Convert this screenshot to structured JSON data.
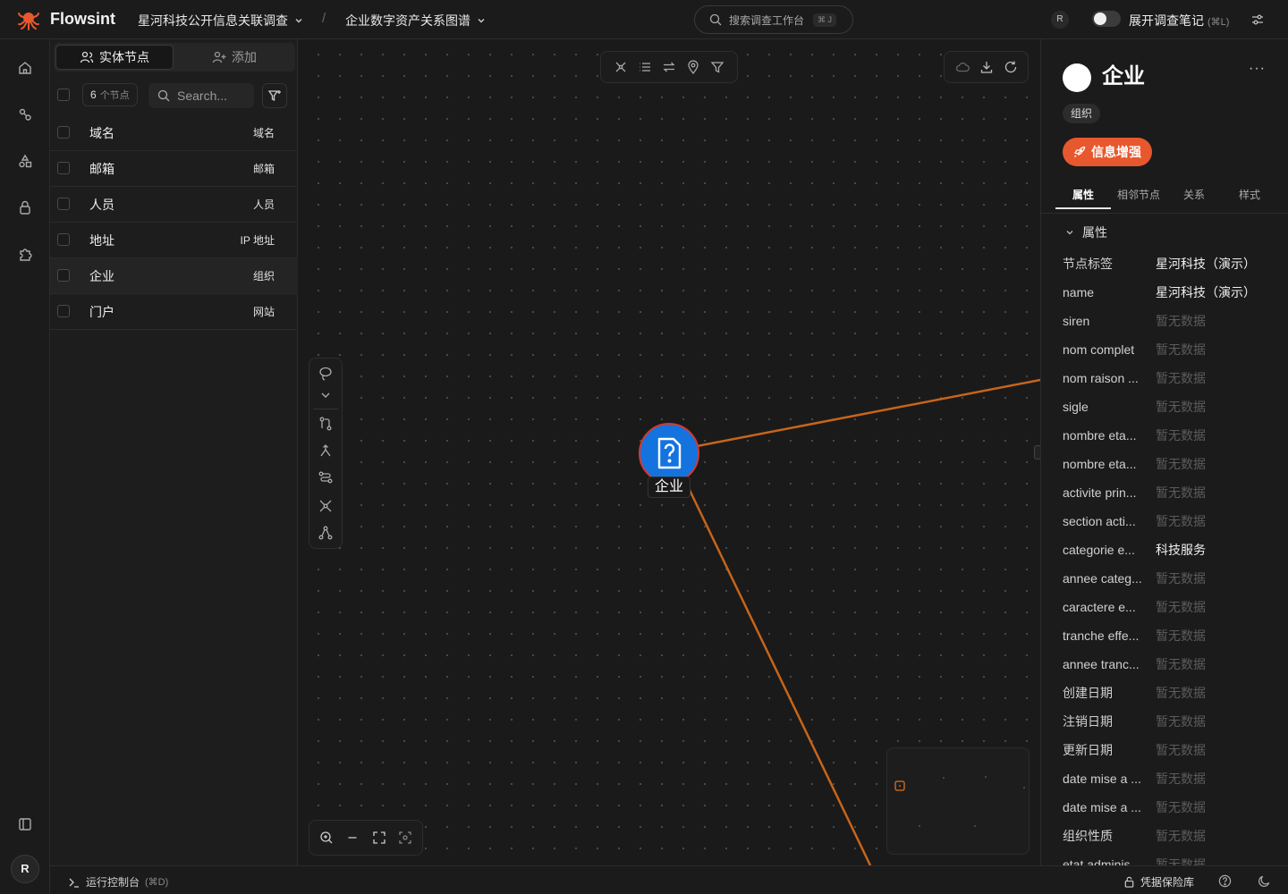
{
  "app": {
    "name": "Flowsint",
    "brand_color": "#e8582e"
  },
  "breadcrumb": {
    "investigation": "星河科技公开信息关联调查",
    "separator": "/",
    "sketch": "企业数字资产关系图谱"
  },
  "search": {
    "placeholder": "搜索调查工作台",
    "shortcut": "⌘ J"
  },
  "header": {
    "avatar": "R",
    "notes_label": "展开调查笔记",
    "notes_shortcut": "(⌘L)"
  },
  "sidebar_nav": {
    "icons": [
      "home-icon",
      "graph-icon",
      "shapes-icon",
      "lock-icon",
      "puzzle-icon"
    ],
    "bottom_icon": "panel-icon",
    "avatar": "R"
  },
  "entity_panel": {
    "tabs": [
      {
        "label": "实体节点",
        "active": true
      },
      {
        "label": "添加",
        "active": false
      }
    ],
    "count": "6",
    "count_unit": "个节点",
    "search_placeholder": "Search...",
    "rows": [
      {
        "name": "域名",
        "type": "域名",
        "selected": false
      },
      {
        "name": "邮箱",
        "type": "邮箱",
        "selected": false
      },
      {
        "name": "人员",
        "type": "人员",
        "selected": false
      },
      {
        "name": "地址",
        "type": "IP 地址",
        "selected": false
      },
      {
        "name": "企业",
        "type": "组织",
        "selected": true
      },
      {
        "name": "门户",
        "type": "网站",
        "selected": false
      }
    ]
  },
  "canvas": {
    "node": {
      "label": "企业",
      "icon": "question-document-icon",
      "fill": "#1573e0",
      "ring": "#d33a2f"
    },
    "edge_color": "#c7651a",
    "top_tools": [
      "layout-icon",
      "list-icon",
      "swap-icon",
      "map-pin-icon",
      "filter-icon"
    ],
    "right_tools": [
      "cloud-icon",
      "download-icon",
      "refresh-icon"
    ],
    "side_tools": [
      "lasso-icon",
      "chevron-down-icon",
      "git-compare-icon",
      "merge-icon",
      "route-icon",
      "network-icon",
      "hierarchy-icon"
    ],
    "zoom_tools": [
      "zoom-in-icon",
      "zoom-out-icon",
      "fit-view-icon",
      "focus-icon"
    ]
  },
  "detail": {
    "title": "企业",
    "badge": "组织",
    "more": "···",
    "enrich_label": "信息增强",
    "tabs": [
      {
        "label": "属性",
        "active": true
      },
      {
        "label": "相邻节点",
        "active": false
      },
      {
        "label": "关系",
        "active": false
      },
      {
        "label": "样式",
        "active": false
      }
    ],
    "section_title": "属性",
    "properties": [
      {
        "key": "节点标签",
        "value": "星河科技（演示）",
        "empty": false
      },
      {
        "key": "name",
        "value": "星河科技（演示）",
        "empty": false
      },
      {
        "key": "siren",
        "value": "暂无数据",
        "empty": true
      },
      {
        "key": "nom complet",
        "value": "暂无数据",
        "empty": true
      },
      {
        "key": "nom raison ...",
        "value": "暂无数据",
        "empty": true
      },
      {
        "key": "sigle",
        "value": "暂无数据",
        "empty": true
      },
      {
        "key": "nombre eta...",
        "value": "暂无数据",
        "empty": true
      },
      {
        "key": "nombre eta...",
        "value": "暂无数据",
        "empty": true
      },
      {
        "key": "activite prin...",
        "value": "暂无数据",
        "empty": true
      },
      {
        "key": "section acti...",
        "value": "暂无数据",
        "empty": true
      },
      {
        "key": "categorie e...",
        "value": "科技服务",
        "empty": false
      },
      {
        "key": "annee categ...",
        "value": "暂无数据",
        "empty": true
      },
      {
        "key": "caractere e...",
        "value": "暂无数据",
        "empty": true
      },
      {
        "key": "tranche effe...",
        "value": "暂无数据",
        "empty": true
      },
      {
        "key": "annee tranc...",
        "value": "暂无数据",
        "empty": true
      },
      {
        "key": "创建日期",
        "value": "暂无数据",
        "empty": true
      },
      {
        "key": "注销日期",
        "value": "暂无数据",
        "empty": true
      },
      {
        "key": "更新日期",
        "value": "暂无数据",
        "empty": true
      },
      {
        "key": "date mise a ...",
        "value": "暂无数据",
        "empty": true
      },
      {
        "key": "date mise a ...",
        "value": "暂无数据",
        "empty": true
      },
      {
        "key": "组织性质",
        "value": "暂无数据",
        "empty": true
      },
      {
        "key": "etat adminis...",
        "value": "暂无数据",
        "empty": true
      }
    ]
  },
  "statusbar": {
    "console_label": "运行控制台",
    "console_shortcut": "(⌘D)",
    "vault_label": "凭据保险库"
  }
}
